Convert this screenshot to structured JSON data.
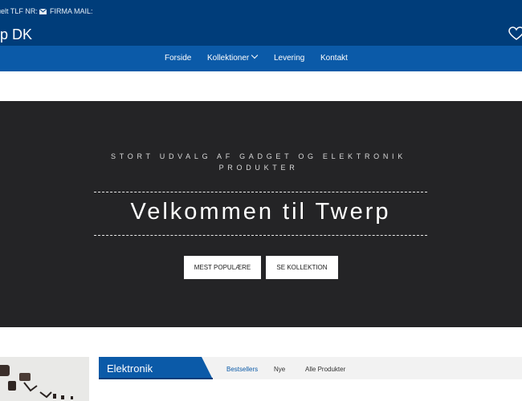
{
  "header": {
    "phone_label": "uelt TLF NR:",
    "mail_label": "FIRMA MAIL:",
    "brand": "rp DK"
  },
  "nav": {
    "items": [
      "Forside",
      "Kollektioner",
      "Levering",
      "Kontakt"
    ]
  },
  "hero": {
    "tagline_line1": "STORT UDVALG AF GADGET OG ELEKTRONIK",
    "tagline_line2": "PRODUKTER",
    "title": "Velkommen til Twerp",
    "buttons": [
      "MEST POPULÆRE",
      "SE KOLLEKTION"
    ]
  },
  "section": {
    "label": "Elektronik",
    "tabs": [
      "Bestsellers",
      "Nye",
      "Alle Produkter"
    ]
  },
  "colors": {
    "topbar": "#003d7a",
    "navbar": "#0b5aa8",
    "hero_bg": "#242426",
    "accent": "#0b5aa8"
  }
}
